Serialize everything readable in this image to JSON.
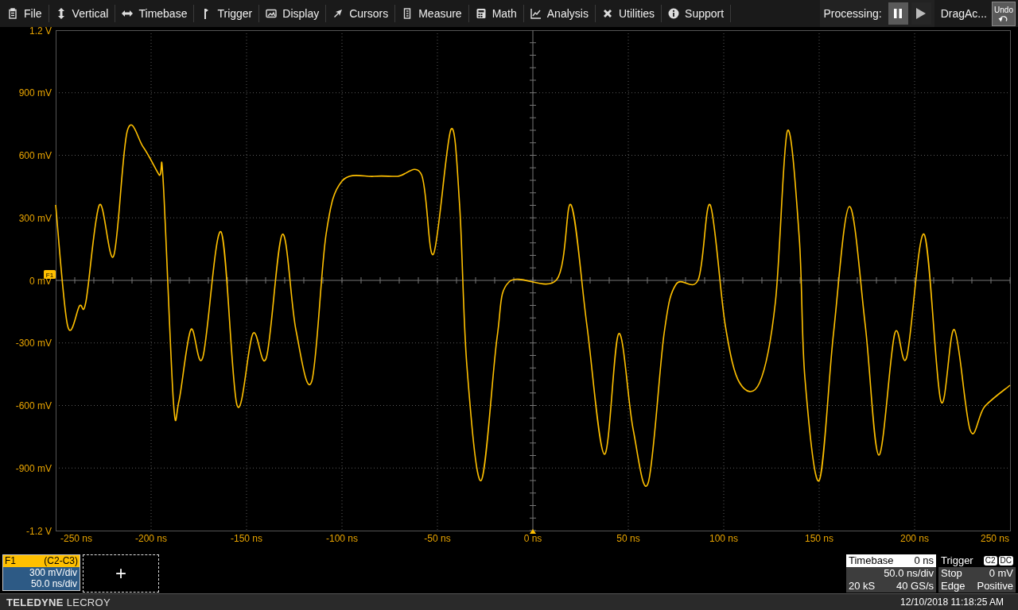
{
  "menu": [
    {
      "label": "File"
    },
    {
      "label": "Vertical"
    },
    {
      "label": "Timebase"
    },
    {
      "label": "Trigger"
    },
    {
      "label": "Display"
    },
    {
      "label": "Cursors"
    },
    {
      "label": "Measure"
    },
    {
      "label": "Math"
    },
    {
      "label": "Analysis"
    },
    {
      "label": "Utilities"
    },
    {
      "label": "Support"
    }
  ],
  "processing": {
    "label": "Processing:",
    "buttons": [
      {
        "kind": "pause",
        "selected": true
      },
      {
        "kind": "play",
        "selected": false
      }
    ]
  },
  "drag_action": "DragAc...",
  "undo_button": "Undo",
  "plot": {
    "y_labels": [
      "1.2 V",
      "900 mV",
      "600 mV",
      "300 mV",
      "0 mV",
      "-300 mV",
      "-600 mV",
      "-900 mV",
      "-1.2 V"
    ],
    "x_labels": [
      "-250 ns",
      "-200 ns",
      "-150 ns",
      "-100 ns",
      "-50 ns",
      "0 ns",
      "50 ns",
      "100 ns",
      "150 ns",
      "200 ns",
      "250 ns"
    ],
    "trace_badge": "F1"
  },
  "trace_descriptor": {
    "name": "F1",
    "source": "(C2-C3)",
    "vertical_scale": "300 mV/div",
    "horizontal_scale": "50.0 ns/div"
  },
  "add_button": "+",
  "timebase": {
    "title": "Timebase",
    "delay": "0 ns",
    "scale": "50.0 ns/div",
    "samples": "20 kS",
    "rate": "40 GS/s"
  },
  "trigger": {
    "title": "Trigger",
    "source": "C2",
    "coupling": "DC",
    "mode": "Stop",
    "level": "0 mV",
    "type": "Edge",
    "slope": "Positive"
  },
  "footer": {
    "brand": "**TELEDYNE** LECROY",
    "datetime": "12/10/2018 11:18:25 AM"
  }
}
